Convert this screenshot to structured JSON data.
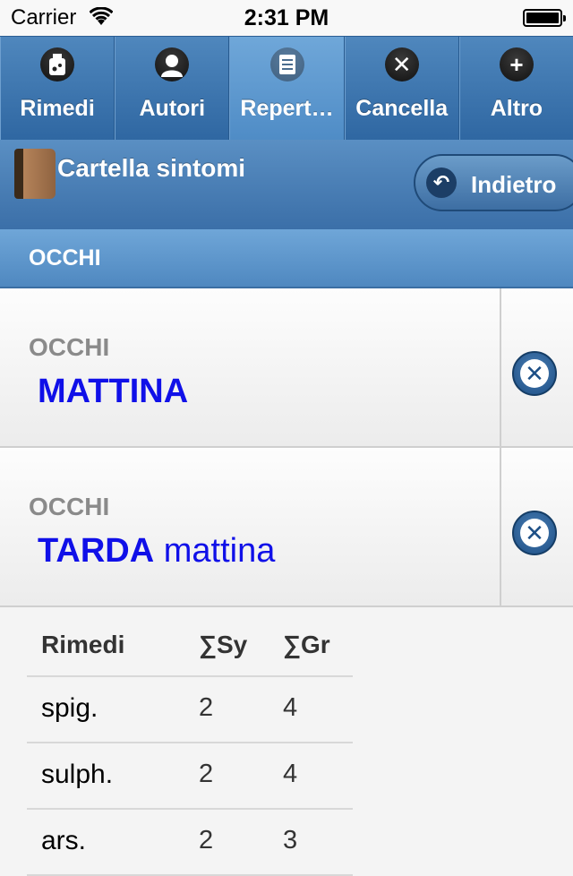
{
  "status": {
    "carrier": "Carrier",
    "time": "2:31 PM"
  },
  "tabs": [
    {
      "label": "Rimedi",
      "icon": "remedy-bottle-icon",
      "active": false
    },
    {
      "label": "Autori",
      "icon": "person-icon",
      "active": false
    },
    {
      "label": "Repert…",
      "icon": "document-list-icon",
      "active": true
    },
    {
      "label": "Cancella",
      "icon": "close-icon",
      "active": false
    },
    {
      "label": "Altro",
      "icon": "plus-icon",
      "active": false
    }
  ],
  "header": {
    "title": "Cartella sintomi",
    "back_label": "Indietro"
  },
  "section": {
    "label": "OCCHI"
  },
  "symptoms": [
    {
      "category": "OCCHI",
      "bold": "MATTINA",
      "rest": ""
    },
    {
      "category": "OCCHI",
      "bold": "TARDA",
      "rest": " mattina"
    }
  ],
  "remedies_table": {
    "headers": [
      "Rimedi",
      "∑Sy",
      "∑Gr"
    ],
    "rows": [
      [
        "spig.",
        "2",
        "4"
      ],
      [
        "sulph.",
        "2",
        "4"
      ],
      [
        "ars.",
        "2",
        "3"
      ]
    ]
  },
  "colors": {
    "accent_blue": "#3b6fa8",
    "symptom_text": "#1010e8"
  }
}
